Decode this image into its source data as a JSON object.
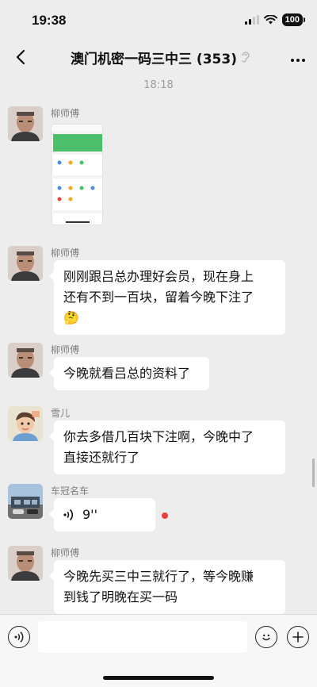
{
  "status_bar": {
    "time": "19:38",
    "battery": "100"
  },
  "nav": {
    "back_icon": "chevron-left-icon",
    "title": "澳门机密一码三中三 (353)",
    "more_icon": "ellipsis-icon"
  },
  "chat": {
    "timestamp": "18:18",
    "messages": [
      {
        "sender": "柳师傅",
        "type": "image"
      },
      {
        "sender": "柳师傅",
        "type": "text",
        "text_line1": "刚刚跟吕总办理好会员，现在身上",
        "text_line2": "还有不到一百块，留着今晚下注了",
        "emoji": "🤔"
      },
      {
        "sender": "柳师傅",
        "type": "text",
        "text": "今晚就看吕总的资料了"
      },
      {
        "sender": "雪儿",
        "type": "text",
        "text_line1": "你去多借几百块下注啊，今晚中了",
        "text_line2": "直接还就行了"
      },
      {
        "sender": "车冠名车",
        "type": "voice",
        "duration": "9''"
      },
      {
        "sender": "柳师傅",
        "type": "text",
        "text_line1": "今晚先买三中三就行了，等今晚赚",
        "text_line2": "到钱了明晚在买一码"
      }
    ]
  },
  "input_bar": {
    "voice_icon": "voice-icon",
    "emoji_icon": "emoji-icon",
    "plus_icon": "plus-icon"
  },
  "colors": {
    "background": "#ededed",
    "bubble": "#ffffff",
    "unread_dot": "#e64340"
  }
}
